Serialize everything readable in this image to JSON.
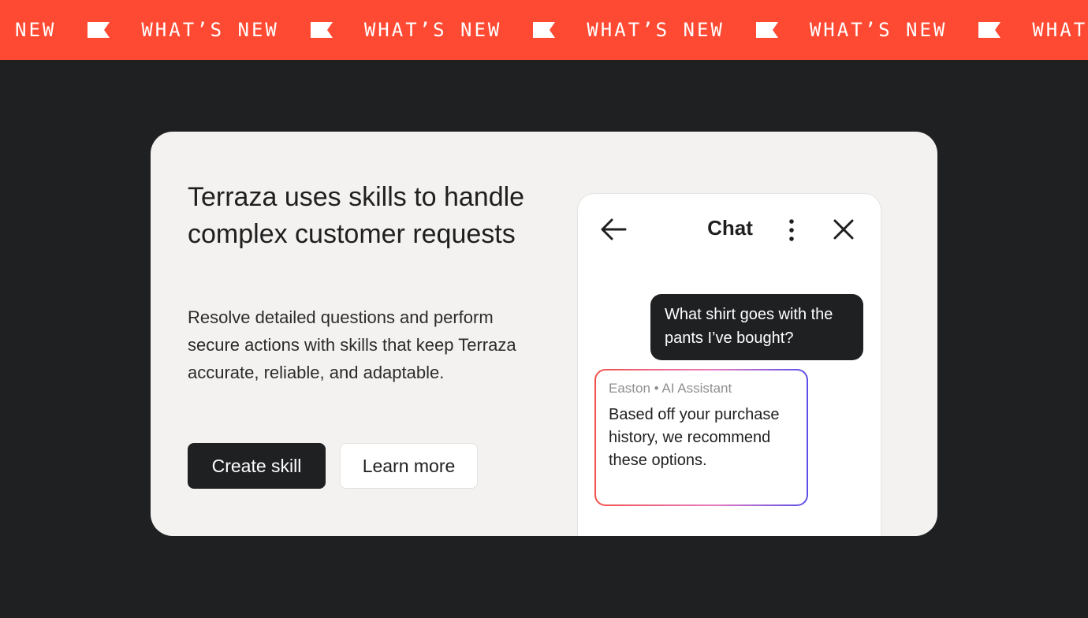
{
  "banner": {
    "items": [
      "NEW",
      "WHAT’S NEW",
      "WHAT’S NEW",
      "WHAT’S NEW",
      "WHAT’S NEW",
      "WHAT"
    ],
    "icon": "flag-icon",
    "background": "#ff4a33"
  },
  "card": {
    "title": "Terraza uses skills to handle complex customer requests",
    "description": "Resolve detailed questions and perform secure actions with skills that keep Terraza accurate, reliable, and adaptable.",
    "primary_button": "Create skill",
    "secondary_button": "Learn more"
  },
  "chat": {
    "title": "Chat",
    "icons": {
      "back": "arrow-left-icon",
      "more": "more-vertical-icon",
      "close": "close-icon"
    },
    "user_message": "What shirt goes with the pants I’ve bought?",
    "assistant_sender": "Easton • AI Assistant",
    "assistant_message": "Based off your purchase history, we recommend these options."
  }
}
